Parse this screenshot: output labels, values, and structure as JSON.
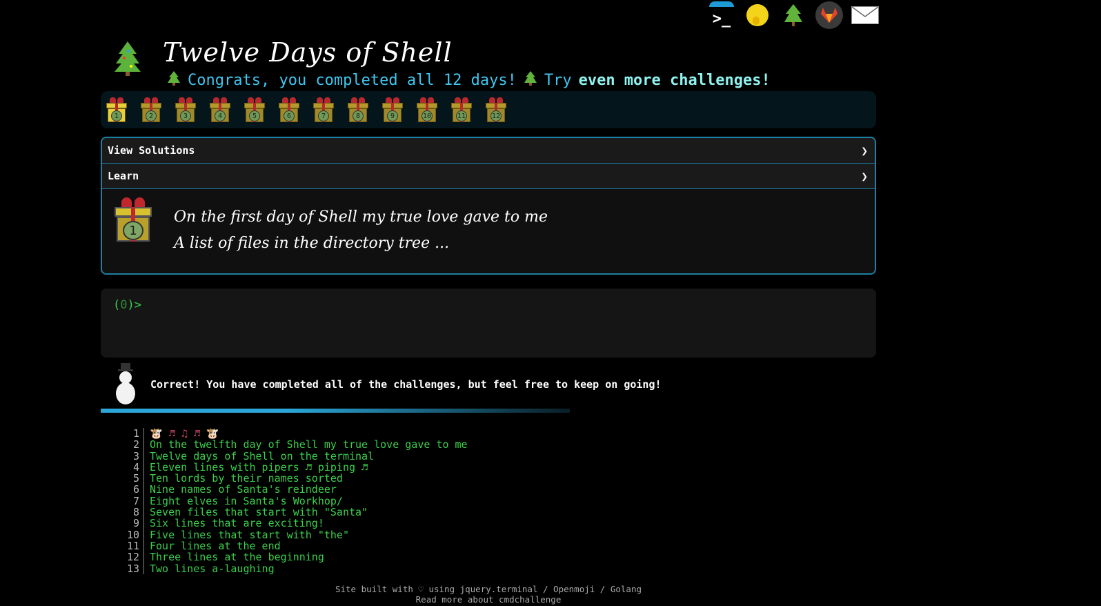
{
  "top_icons": [
    {
      "name": "terminal-icon"
    },
    {
      "name": "shush-face-icon"
    },
    {
      "name": "christmas-tree-icon"
    },
    {
      "name": "gitlab-fox-icon"
    },
    {
      "name": "mail-icon"
    }
  ],
  "header": {
    "title": "Twelve Days of Shell",
    "congrats": "Congrats, you completed all 12 days!",
    "try_text": "Try",
    "more_link": "even more challenges!"
  },
  "days": [
    "1",
    "2",
    "3",
    "4",
    "5",
    "6",
    "7",
    "8",
    "9",
    "10",
    "11",
    "12"
  ],
  "accordion": {
    "solutions": "View Solutions",
    "learn": "Learn",
    "chevron": "❯"
  },
  "verse": {
    "gift_number": "1",
    "line1": "On the first day of Shell my true love gave to me",
    "line2": "A list of files in the directory tree ..."
  },
  "terminal": {
    "prompt_open": "(",
    "prompt_count": "0",
    "prompt_close": ")>"
  },
  "result": {
    "message": "Correct! You have completed all of the challenges, but feel free to keep on going!"
  },
  "listing": [
    {
      "n": "1",
      "text": "🐮 ♬ ♫ ♬ 🐮"
    },
    {
      "n": "2",
      "text": "On the twelfth day of Shell my true love gave to me"
    },
    {
      "n": "3",
      "text": "Twelve days of Shell on the terminal"
    },
    {
      "n": "4",
      "text": "Eleven lines with pipers ♬ piping ♬"
    },
    {
      "n": "5",
      "text": "Ten lords by their names sorted"
    },
    {
      "n": "6",
      "text": "Nine names of Santa's reindeer"
    },
    {
      "n": "7",
      "text": "Eight elves in Santa's Workhop/"
    },
    {
      "n": "8",
      "text": "Seven files that start with \"Santa\""
    },
    {
      "n": "9",
      "text": "Six lines that are exciting!"
    },
    {
      "n": "10",
      "text": "Five lines that start with \"the\""
    },
    {
      "n": "11",
      "text": "Four lines at the end"
    },
    {
      "n": "12",
      "text": "Three lines at the beginning"
    },
    {
      "n": "13",
      "text": "Two lines a-laughing"
    }
  ],
  "footer": {
    "line1": "Site built with ♡ using jquery.terminal / Openmoji / Golang",
    "line2": "Read more about cmdchallenge"
  }
}
